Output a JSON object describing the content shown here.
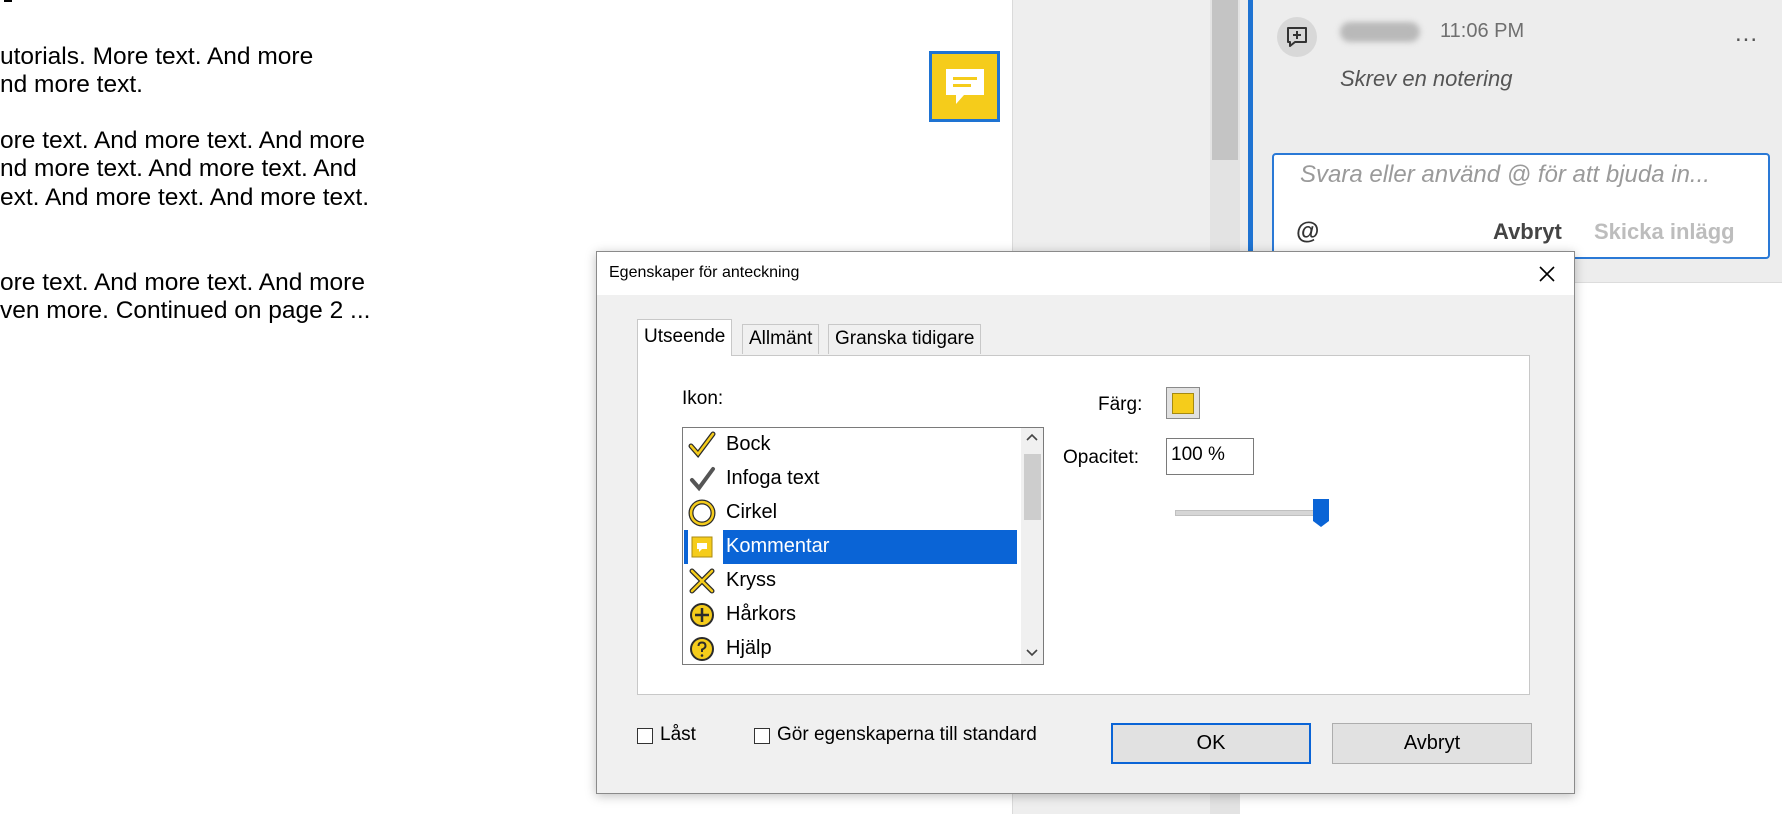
{
  "document": {
    "lines": [
      "utorials. More text. And more",
      "nd more text.",
      "ore text. And more text. And more",
      "nd more text. And more text. And",
      "ext. And more text. And more text.",
      "ore text. And more text. And more",
      "ven more. Continued on page 2 ..."
    ]
  },
  "comment": {
    "time": "11:06 PM",
    "more": "...",
    "text": "Skrev en notering",
    "reply_placeholder": "Svara eller använd @ för att bjuda in...",
    "at": "@",
    "cancel": "Avbryt",
    "send": "Skicka inlägg"
  },
  "dialog": {
    "title": "Egenskaper för anteckning",
    "tabs": [
      "Utseende",
      "Allmänt",
      "Granska tidigare"
    ],
    "icon_label": "Ikon:",
    "icons": [
      {
        "label": "Bock",
        "icon": "checkmark-icon"
      },
      {
        "label": "Infoga text",
        "icon": "insert-text-icon"
      },
      {
        "label": "Cirkel",
        "icon": "circle-icon"
      },
      {
        "label": "Kommentar",
        "icon": "comment-icon"
      },
      {
        "label": "Kryss",
        "icon": "cross-icon"
      },
      {
        "label": "Hårkors",
        "icon": "crosshair-icon"
      },
      {
        "label": "Hjälp",
        "icon": "help-icon"
      }
    ],
    "selected_icon": "Kommentar",
    "color_label": "Färg:",
    "color": "#f5cc1b",
    "opacity_label": "Opacitet:",
    "opacity_value": "100 %",
    "opacity_fraction": 1.0,
    "locked_label": "Låst",
    "default_label": "Gör egenskaperna till standard",
    "ok": "OK",
    "cancel": "Avbryt"
  },
  "colors": {
    "accent": "#1e73d2",
    "selection": "#0a64d6",
    "note_yellow": "#f5cc1b"
  }
}
